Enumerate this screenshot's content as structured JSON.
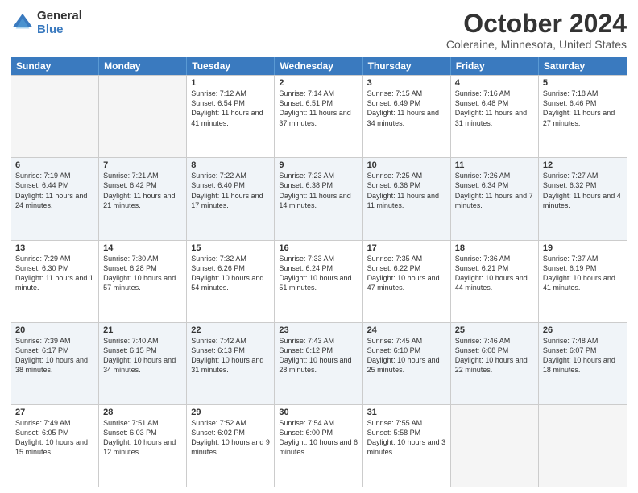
{
  "logo": {
    "general": "General",
    "blue": "Blue"
  },
  "title": "October 2024",
  "subtitle": "Coleraine, Minnesota, United States",
  "days_of_week": [
    "Sunday",
    "Monday",
    "Tuesday",
    "Wednesday",
    "Thursday",
    "Friday",
    "Saturday"
  ],
  "weeks": [
    [
      {
        "day": "",
        "empty": true
      },
      {
        "day": "",
        "empty": true
      },
      {
        "day": "1",
        "sunrise": "7:12 AM",
        "sunset": "6:54 PM",
        "daylight": "11 hours and 41 minutes."
      },
      {
        "day": "2",
        "sunrise": "7:14 AM",
        "sunset": "6:51 PM",
        "daylight": "11 hours and 37 minutes."
      },
      {
        "day": "3",
        "sunrise": "7:15 AM",
        "sunset": "6:49 PM",
        "daylight": "11 hours and 34 minutes."
      },
      {
        "day": "4",
        "sunrise": "7:16 AM",
        "sunset": "6:48 PM",
        "daylight": "11 hours and 31 minutes."
      },
      {
        "day": "5",
        "sunrise": "7:18 AM",
        "sunset": "6:46 PM",
        "daylight": "11 hours and 27 minutes."
      }
    ],
    [
      {
        "day": "6",
        "sunrise": "7:19 AM",
        "sunset": "6:44 PM",
        "daylight": "11 hours and 24 minutes."
      },
      {
        "day": "7",
        "sunrise": "7:21 AM",
        "sunset": "6:42 PM",
        "daylight": "11 hours and 21 minutes."
      },
      {
        "day": "8",
        "sunrise": "7:22 AM",
        "sunset": "6:40 PM",
        "daylight": "11 hours and 17 minutes."
      },
      {
        "day": "9",
        "sunrise": "7:23 AM",
        "sunset": "6:38 PM",
        "daylight": "11 hours and 14 minutes."
      },
      {
        "day": "10",
        "sunrise": "7:25 AM",
        "sunset": "6:36 PM",
        "daylight": "11 hours and 11 minutes."
      },
      {
        "day": "11",
        "sunrise": "7:26 AM",
        "sunset": "6:34 PM",
        "daylight": "11 hours and 7 minutes."
      },
      {
        "day": "12",
        "sunrise": "7:27 AM",
        "sunset": "6:32 PM",
        "daylight": "11 hours and 4 minutes."
      }
    ],
    [
      {
        "day": "13",
        "sunrise": "7:29 AM",
        "sunset": "6:30 PM",
        "daylight": "11 hours and 1 minute."
      },
      {
        "day": "14",
        "sunrise": "7:30 AM",
        "sunset": "6:28 PM",
        "daylight": "10 hours and 57 minutes."
      },
      {
        "day": "15",
        "sunrise": "7:32 AM",
        "sunset": "6:26 PM",
        "daylight": "10 hours and 54 minutes."
      },
      {
        "day": "16",
        "sunrise": "7:33 AM",
        "sunset": "6:24 PM",
        "daylight": "10 hours and 51 minutes."
      },
      {
        "day": "17",
        "sunrise": "7:35 AM",
        "sunset": "6:22 PM",
        "daylight": "10 hours and 47 minutes."
      },
      {
        "day": "18",
        "sunrise": "7:36 AM",
        "sunset": "6:21 PM",
        "daylight": "10 hours and 44 minutes."
      },
      {
        "day": "19",
        "sunrise": "7:37 AM",
        "sunset": "6:19 PM",
        "daylight": "10 hours and 41 minutes."
      }
    ],
    [
      {
        "day": "20",
        "sunrise": "7:39 AM",
        "sunset": "6:17 PM",
        "daylight": "10 hours and 38 minutes."
      },
      {
        "day": "21",
        "sunrise": "7:40 AM",
        "sunset": "6:15 PM",
        "daylight": "10 hours and 34 minutes."
      },
      {
        "day": "22",
        "sunrise": "7:42 AM",
        "sunset": "6:13 PM",
        "daylight": "10 hours and 31 minutes."
      },
      {
        "day": "23",
        "sunrise": "7:43 AM",
        "sunset": "6:12 PM",
        "daylight": "10 hours and 28 minutes."
      },
      {
        "day": "24",
        "sunrise": "7:45 AM",
        "sunset": "6:10 PM",
        "daylight": "10 hours and 25 minutes."
      },
      {
        "day": "25",
        "sunrise": "7:46 AM",
        "sunset": "6:08 PM",
        "daylight": "10 hours and 22 minutes."
      },
      {
        "day": "26",
        "sunrise": "7:48 AM",
        "sunset": "6:07 PM",
        "daylight": "10 hours and 18 minutes."
      }
    ],
    [
      {
        "day": "27",
        "sunrise": "7:49 AM",
        "sunset": "6:05 PM",
        "daylight": "10 hours and 15 minutes."
      },
      {
        "day": "28",
        "sunrise": "7:51 AM",
        "sunset": "6:03 PM",
        "daylight": "10 hours and 12 minutes."
      },
      {
        "day": "29",
        "sunrise": "7:52 AM",
        "sunset": "6:02 PM",
        "daylight": "10 hours and 9 minutes."
      },
      {
        "day": "30",
        "sunrise": "7:54 AM",
        "sunset": "6:00 PM",
        "daylight": "10 hours and 6 minutes."
      },
      {
        "day": "31",
        "sunrise": "7:55 AM",
        "sunset": "5:58 PM",
        "daylight": "10 hours and 3 minutes."
      },
      {
        "day": "",
        "empty": true
      },
      {
        "day": "",
        "empty": true
      }
    ]
  ]
}
